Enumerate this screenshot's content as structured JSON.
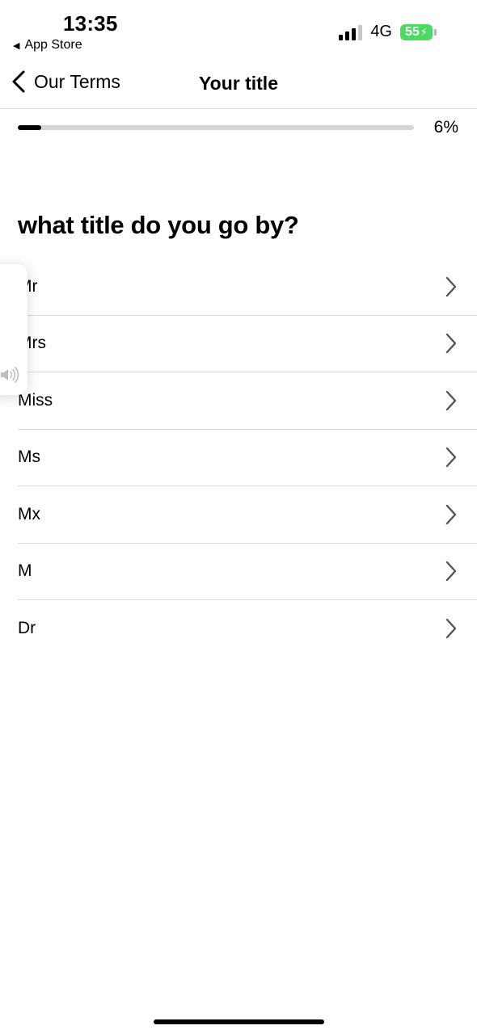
{
  "status_bar": {
    "time": "13:35",
    "back_app": "App Store",
    "network": "4G",
    "battery": "55"
  },
  "nav": {
    "back_label": "Our Terms",
    "title": "Your title"
  },
  "progress": {
    "percent": 6,
    "label": "6%"
  },
  "question": "what title do you go by?",
  "options": [
    "Mr",
    "Mrs",
    "Miss",
    "Ms",
    "Mx",
    "M",
    "Dr"
  ],
  "icons": {
    "nav_back": "chevron-left-icon",
    "option_chevron": "chevron-right-icon",
    "audio": "speaker-icon"
  },
  "colors": {
    "battery_green": "#4cd964",
    "progress_fill": "#000000",
    "progress_track": "#d6d6d6",
    "divider": "#d9d9d9"
  }
}
